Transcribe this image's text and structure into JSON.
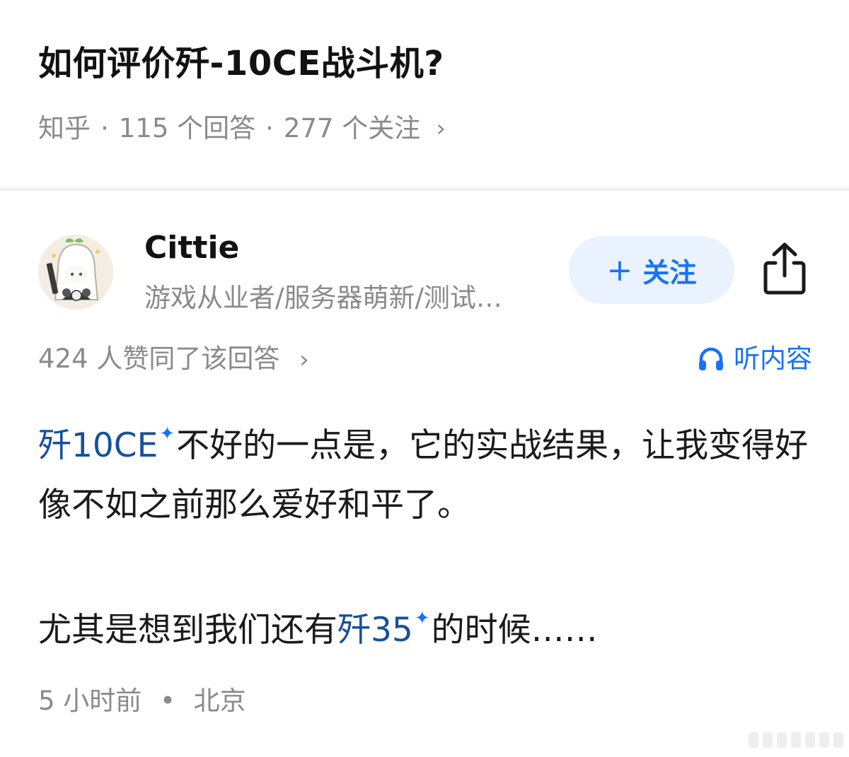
{
  "question": {
    "title": "如何评价歼-10CE战斗机?",
    "source": "知乎",
    "separator": "·",
    "answers": "115 个回答",
    "followers": "277 个关注",
    "chevron": "›"
  },
  "author": {
    "name": "Cittie",
    "bio": "游戏从业者/服务器萌新/测试…",
    "follow_icon": "+",
    "follow_label": "关注",
    "share_icon": "share-icon"
  },
  "answer": {
    "votes": "424 人赞同了该回答",
    "votes_chevron": "›",
    "listen_label": "听内容",
    "listen_icon": "headphones-icon",
    "paragraph1": {
      "link": "歼10CE",
      "spark": "✦",
      "text": "不好的一点是，它的实战结果，让我变得好像不如之前那么爱好和平了。"
    },
    "paragraph2": {
      "before": "尤其是想到我们还有",
      "link": "歼35",
      "spark": "✦",
      "after": "的时候……"
    },
    "time": "5 小时前",
    "dot": "•",
    "location": "北京"
  },
  "colors": {
    "accent": "#1772f6",
    "link": "#175199",
    "muted": "#8a8a8a",
    "follow_bg": "#e9f2fd"
  }
}
